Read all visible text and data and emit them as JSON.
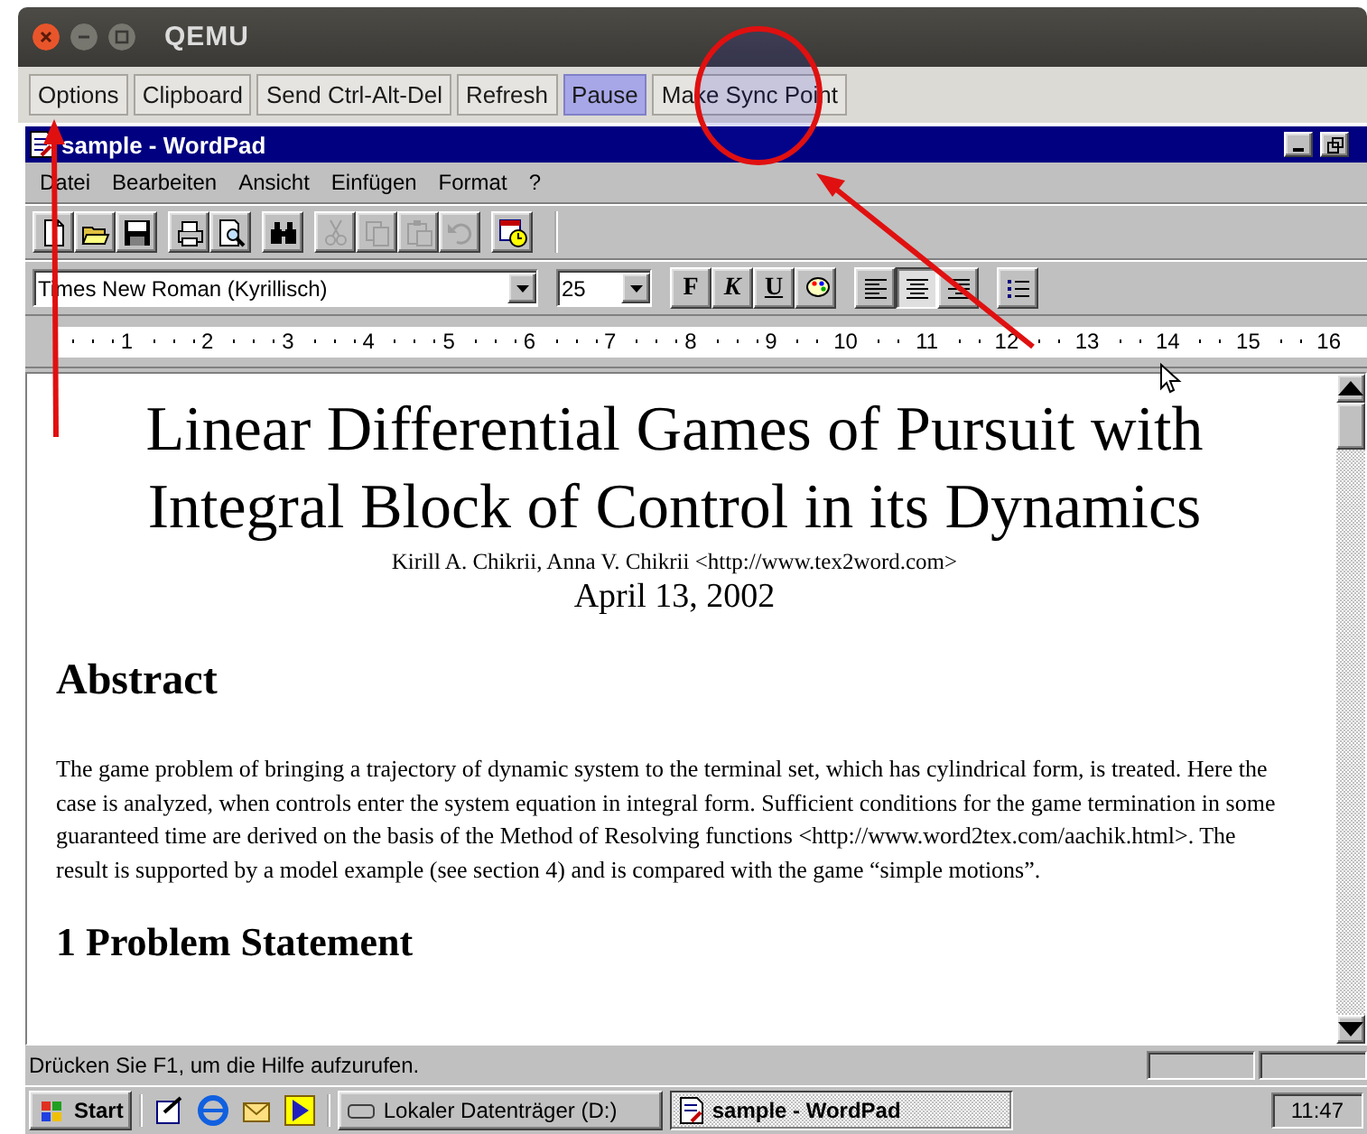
{
  "qemu": {
    "title": "QEMU",
    "buttons": [
      {
        "label": "Options",
        "selected": false
      },
      {
        "label": "Clipboard",
        "selected": false
      },
      {
        "label": "Send Ctrl-Alt-Del",
        "selected": false
      },
      {
        "label": "Refresh",
        "selected": false
      },
      {
        "label": "Pause",
        "selected": true
      },
      {
        "label": "Make Sync Point",
        "selected": false
      }
    ]
  },
  "wordpad": {
    "title": "sample - WordPad",
    "menu": [
      "Datei",
      "Bearbeiten",
      "Ansicht",
      "Einfügen",
      "Format",
      "?"
    ],
    "toolbar": [
      [
        {
          "disabled": false
        },
        {
          "disabled": false
        },
        {
          "disabled": false
        }
      ],
      [
        {
          "disabled": false
        },
        {
          "disabled": false
        }
      ],
      [
        {
          "disabled": false
        }
      ],
      [
        {
          "disabled": true
        },
        {
          "disabled": true
        },
        {
          "disabled": true
        },
        {
          "disabled": true
        }
      ],
      [
        {
          "disabled": false
        }
      ]
    ],
    "format_bar": {
      "font": "Times New Roman (Kyrillisch)",
      "size": "25",
      "style_buttons": [
        {
          "label": "F",
          "selected": false
        },
        {
          "label": "K",
          "selected": false
        },
        {
          "label": "U",
          "selected": false
        }
      ],
      "align_buttons": [
        {
          "selected": false
        },
        {
          "selected": true
        },
        {
          "selected": false
        }
      ]
    },
    "ruler": [
      "1",
      "2",
      "3",
      "4",
      "5",
      "6",
      "7",
      "8",
      "9",
      "10",
      "11",
      "12",
      "13",
      "14",
      "15",
      "16"
    ],
    "document": {
      "title": "Linear Differential Games of Pursuit with Integral Block of Control in its Dynamics",
      "authors": "Kirill A. Chikrii, Anna V. Chikrii <http://www.tex2word.com>",
      "date": "April 13, 2002",
      "abstract_heading": "Abstract",
      "abstract": "The game problem of bringing a trajectory of dynamic system to the terminal set, which has cylindrical form, is treated. Here the case is analyzed, when controls enter the system equation in integral form. Sufficient conditions for the game termination in some guaranteed time are derived on the basis of the Method of Resolving functions <http://www.word2tex.com/aachik.html>. The result is supported by a model example (see section 4) and is compared with the game “simple motions”.",
      "section_heading": "1  Problem Statement"
    },
    "status_bar": "Drücken Sie F1, um die Hilfe aufzurufen."
  },
  "taskbar": {
    "start": "Start",
    "tasks": [
      {
        "label": "Lokaler Datenträger (D:)",
        "selected": false
      },
      {
        "label": "sample - WordPad",
        "selected": true
      }
    ],
    "clock": "11:47"
  }
}
